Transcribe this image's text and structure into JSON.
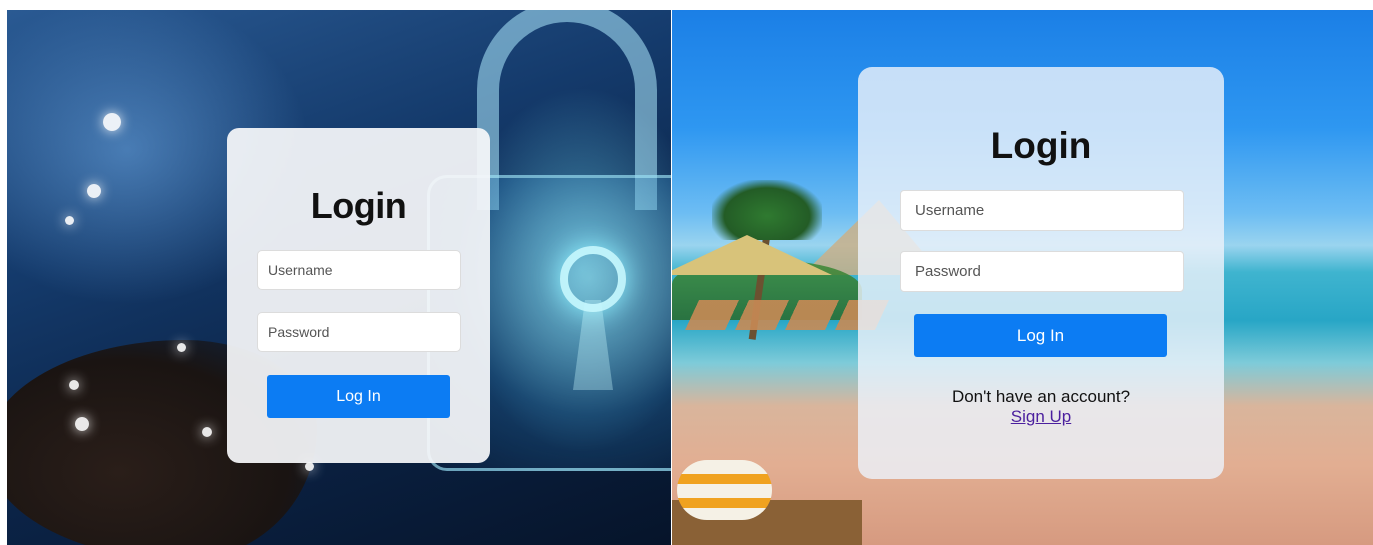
{
  "left_login": {
    "title": "Login",
    "username_placeholder": "Username",
    "password_placeholder": "Password",
    "login_button": "Log In"
  },
  "right_login": {
    "title": "Login",
    "username_placeholder": "Username",
    "password_placeholder": "Password",
    "login_button": "Log In",
    "signup_prompt": "Don't have an account?",
    "signup_link": "Sign Up"
  },
  "colors": {
    "button": "#0c7cf3",
    "link": "#4b1f9e"
  }
}
